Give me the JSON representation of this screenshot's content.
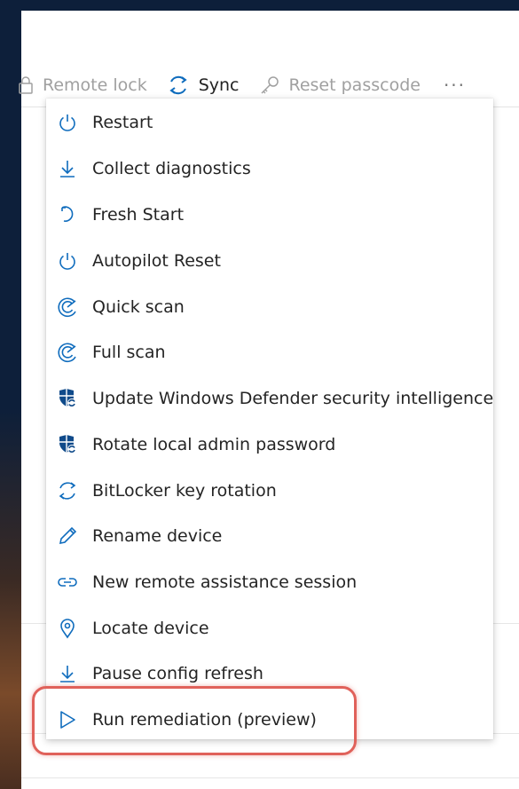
{
  "toolbar": {
    "remote_lock": "Remote lock",
    "sync": "Sync",
    "reset_passcode": "Reset passcode",
    "more": "···"
  },
  "menu": {
    "items": [
      {
        "label": "Restart",
        "icon": "power-icon"
      },
      {
        "label": "Collect diagnostics",
        "icon": "download-icon"
      },
      {
        "label": "Fresh Start",
        "icon": "undo-icon"
      },
      {
        "label": "Autopilot Reset",
        "icon": "power-icon"
      },
      {
        "label": "Quick scan",
        "icon": "scan-icon"
      },
      {
        "label": "Full scan",
        "icon": "scan-icon"
      },
      {
        "label": "Update Windows Defender security intelligence",
        "icon": "defender-update-icon"
      },
      {
        "label": "Rotate local admin password",
        "icon": "defender-update-icon"
      },
      {
        "label": "BitLocker key rotation",
        "icon": "sync-icon"
      },
      {
        "label": "Rename device",
        "icon": "pencil-icon"
      },
      {
        "label": "New remote assistance session",
        "icon": "link-icon"
      },
      {
        "label": "Locate device",
        "icon": "location-pin-icon"
      },
      {
        "label": "Pause config refresh",
        "icon": "download-icon"
      },
      {
        "label": "Run remediation (preview)",
        "icon": "play-icon"
      }
    ]
  },
  "colors": {
    "accent": "#0f6cbd",
    "highlight": "#e0615a",
    "text": "#242424",
    "disabled_text": "#a0a0a0"
  }
}
